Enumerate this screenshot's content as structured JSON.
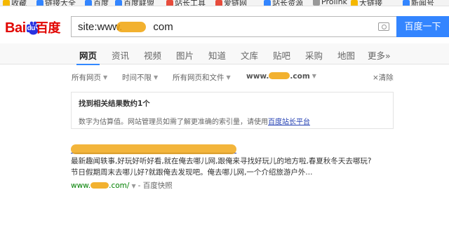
{
  "bookmarks": [
    {
      "label": "收藏",
      "color": "#f5b800"
    },
    {
      "label": "链接大全",
      "color": "#3385ff"
    },
    {
      "label": "百度",
      "color": "#3385ff"
    },
    {
      "label": "百度联盟",
      "color": "#3385ff"
    },
    {
      "label": "站长工具",
      "color": "#e74c3c"
    },
    {
      "label": "爱链网",
      "color": "#e74c3c"
    },
    {
      "label": "站长资源",
      "color": "#3385ff"
    },
    {
      "label": "Prolink",
      "color": "#999999"
    },
    {
      "label": "大链接",
      "color": "#f5b800"
    },
    {
      "label": "新闻号",
      "color": "#3385ff"
    }
  ],
  "header": {
    "logo_text": "Bai",
    "logo_du": "du",
    "logo_cn": "百度",
    "search_prefix": "site:www.",
    "search_suffix": "com",
    "search_button": "百度一下"
  },
  "tabs": [
    "网页",
    "资讯",
    "视频",
    "图片",
    "知道",
    "文库",
    "贴吧",
    "采购",
    "地图",
    "更多»"
  ],
  "filters": {
    "pages": "所有网页",
    "time": "时间不限",
    "filetype": "所有网页和文件",
    "site_prefix": "www.",
    "site_suffix": ".com",
    "clear": "×清除"
  },
  "info": {
    "title": "找到相关结果数约1个",
    "desc_prefix": "数字为估算值。网站管理员如需了解更准确的索引量，请使用",
    "desc_link": "百度站长平台"
  },
  "result": {
    "abstract_line1": "最新趣闻轶事,好玩好听好看,就在俺去哪儿网,跟俺来寻找好玩儿的地方啦,春夏秋冬天去哪玩?",
    "abstract_line2": "节日假期周末去哪儿好?就跟俺去发现吧。俺去哪儿网,一个介绍旅游户外...",
    "url_prefix": "www.",
    "url_suffix": ".com/",
    "snapshot": "- 百度快照"
  },
  "colors": {
    "brand_blue": "#3385ff",
    "brand_red": "#e10602",
    "link_blue": "#2440b3",
    "url_green": "#008000",
    "redaction": "#f0a30a"
  }
}
